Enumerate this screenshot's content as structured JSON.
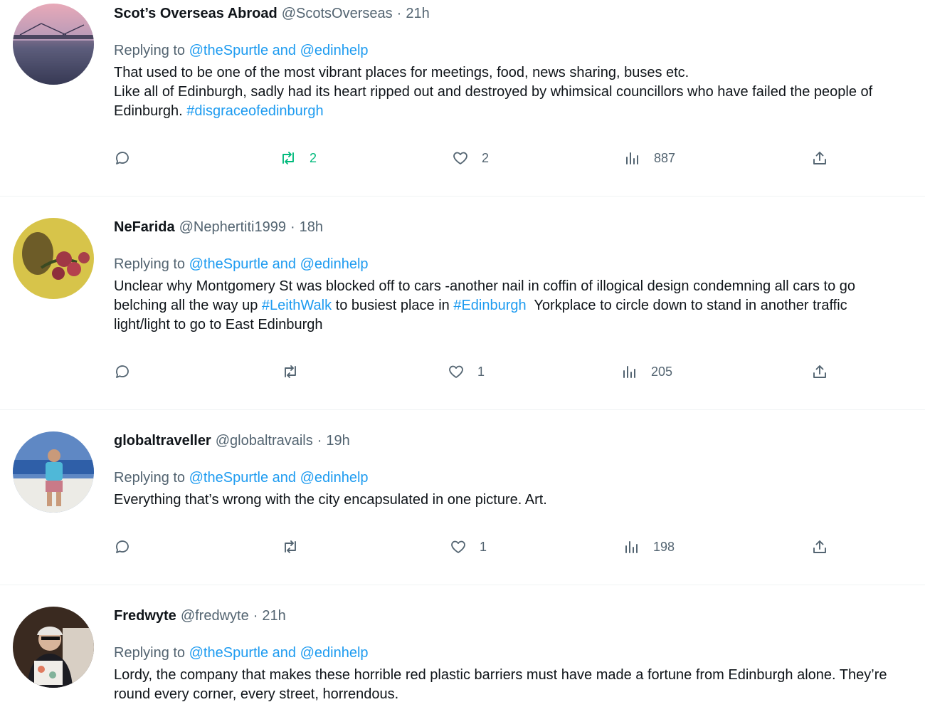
{
  "feed": {
    "tweets": [
      {
        "name": "Scot’s Overseas Abroad",
        "handle": "@ScotsOverseas",
        "time": "21h",
        "replying_prefix": "Replying to",
        "replying_to": "@theSpurtle and @edinhelp",
        "lines": [
          [
            "That used to be one of the most vibrant places for meetings, food, news sharing, buses etc."
          ],
          [
            "Like all of Edinburgh, sadly had its heart ripped out and destroyed by whimsical councillors who have failed the people of"
          ],
          [
            "Edinburgh. ",
            "#disgraceofedinburgh"
          ]
        ],
        "stats": {
          "replies": "",
          "retweets": "2",
          "likes": "2",
          "views": "887"
        }
      },
      {
        "name": "NeFarida",
        "handle": "@Nephertiti1999",
        "time": "18h",
        "replying_prefix": "Replying to",
        "replying_to": "@theSpurtle and @edinhelp",
        "lines": [
          [
            "Unclear why Montgomery St was blocked off to cars -another nail in coffin of illogical design condemning all cars to go"
          ],
          [
            "belching all the way up ",
            "#LeithWalk",
            " to busiest place in ",
            "#Edinburgh",
            "  Yorkplace to circle down to stand in another traffic"
          ],
          [
            "light/light to go to East Edinburgh"
          ]
        ],
        "stats": {
          "replies": "",
          "retweets": "",
          "likes": "1",
          "views": "205"
        }
      },
      {
        "name": "globaltraveller",
        "handle": "@globaltravails",
        "time": "19h",
        "replying_prefix": "Replying to",
        "replying_to": "@theSpurtle and @edinhelp",
        "lines": [
          [
            "Everything that’s wrong with the city encapsulated in one picture. Art."
          ]
        ],
        "stats": {
          "replies": "",
          "retweets": "",
          "likes": "1",
          "views": "198"
        }
      },
      {
        "name": "Fredwyte",
        "handle": "@fredwyte",
        "time": "21h",
        "replying_prefix": "Replying to",
        "replying_to": "@theSpurtle and @edinhelp",
        "lines": [
          [
            "Lordy, the company that makes these horrible red plastic barriers must have made a fortune from Edinburgh alone. They’re"
          ],
          [
            "round every corner, every street, horrendous."
          ]
        ],
        "stats": {
          "replies": "",
          "retweets": "",
          "likes": "",
          "views": ""
        }
      }
    ],
    "separator": "·",
    "colors": {
      "text": "#0f1419",
      "secondary": "#536471",
      "link": "#1d9bf0",
      "retweet_active": "#00ba7c",
      "divider": "#eff3f4"
    },
    "icons": [
      "reply-icon",
      "retweet-icon",
      "like-icon",
      "views-icon",
      "share-icon"
    ]
  }
}
